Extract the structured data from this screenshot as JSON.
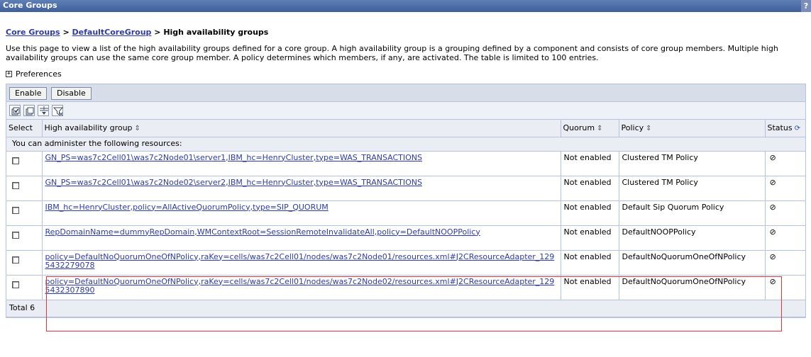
{
  "window": {
    "title": "Core Groups",
    "help_label": "?"
  },
  "breadcrumb": {
    "items": [
      {
        "label": "Core Groups"
      },
      {
        "label": "DefaultCoreGroup"
      }
    ],
    "separator": ">",
    "current": "High availability groups"
  },
  "description": "Use this page to view a list of the high availability groups defined for a core group. A high availability group is a grouping defined by a component and consists of core group members. Multiple high availability groups can use the same core group member. A policy determines which members, if any, are activated. The table is limited to 100 entries.",
  "preferences": {
    "label": "Preferences",
    "expand_symbol": "+"
  },
  "buttons": {
    "enable": "Enable",
    "disable": "Disable"
  },
  "toolbar_icons": [
    "select-all-icon",
    "deselect-all-icon",
    "expand-filter-icon",
    "clear-filter-icon"
  ],
  "table": {
    "columns": {
      "select": "Select",
      "group": "High availability group",
      "quorum": "Quorum",
      "policy": "Policy",
      "status": "Status"
    },
    "info_text": "You can administer the following resources:",
    "rows": [
      {
        "group": "GN_PS=was7c2Cell01\\was7c2Node01\\server1,IBM_hc=HenryCluster,type=WAS_TRANSACTIONS",
        "quorum": "Not enabled",
        "policy": "Clustered TM Policy",
        "status": "⊘"
      },
      {
        "group": "GN_PS=was7c2Cell01\\was7c2Node02\\server2,IBM_hc=HenryCluster,type=WAS_TRANSACTIONS",
        "quorum": "Not enabled",
        "policy": "Clustered TM Policy",
        "status": "⊘"
      },
      {
        "group": "IBM_hc=HenryCluster,policy=AllActiveQuorumPolicy,type=SIP_QUORUM",
        "quorum": "Not enabled",
        "policy": "Default Sip Quorum Policy",
        "status": "⊘"
      },
      {
        "group": "RepDomainName=dummyRepDomain,WMContextRoot=SessionRemoteInvalidateAll,policy=DefaultNOOPPolicy",
        "quorum": "Not enabled",
        "policy": "DefaultNOOPPolicy",
        "status": "⊘"
      },
      {
        "group": "policy=DefaultNoQuorumOneOfNPolicy,raKey=cells/was7c2Cell01/nodes/was7c2Node01/resources.xml#J2CResourceAdapter_1295432279078",
        "quorum": "Not enabled",
        "policy": "DefaultNoQuorumOneOfNPolicy",
        "status": "⊘"
      },
      {
        "group": "policy=DefaultNoQuorumOneOfNPolicy,raKey=cells/was7c2Cell01/nodes/was7c2Node02/resources.xml#J2CResourceAdapter_1295432307890",
        "quorum": "Not enabled",
        "policy": "DefaultNoQuorumOneOfNPolicy",
        "status": "⊘"
      }
    ],
    "total": "Total 6"
  },
  "colors": {
    "link": "#2d3ba6",
    "header_bg": "#3e5f9b",
    "highlight": "#e3363a",
    "panel_bg": "#d7dde9"
  }
}
